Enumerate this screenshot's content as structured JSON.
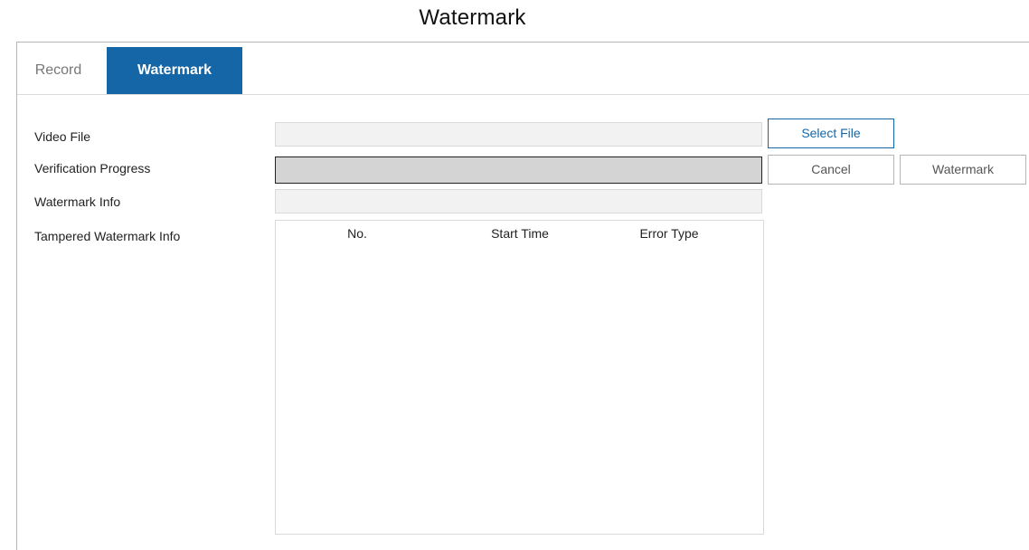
{
  "window": {
    "title": "Watermark"
  },
  "tabs": [
    {
      "label": "Record",
      "active": false
    },
    {
      "label": "Watermark",
      "active": true
    }
  ],
  "form": {
    "video_file": {
      "label": "Video File",
      "value": ""
    },
    "verification_progress": {
      "label": "Verification Progress",
      "value_percent": 100
    },
    "watermark_info": {
      "label": "Watermark Info",
      "value": ""
    },
    "tampered_info": {
      "label": "Tampered Watermark Info"
    }
  },
  "buttons": {
    "select_file": "Select File",
    "cancel": "Cancel",
    "watermark": "Watermark"
  },
  "table": {
    "columns": [
      "No.",
      "Start Time",
      "Error Type"
    ],
    "rows": []
  },
  "colors": {
    "accent": "#1566a6",
    "input_bg": "#f2f2f2",
    "progress_fill": "#d4d4d4"
  }
}
